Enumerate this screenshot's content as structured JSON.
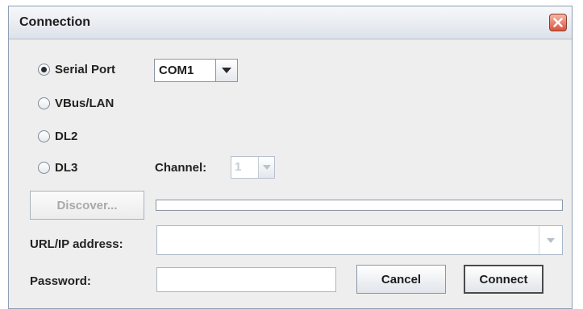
{
  "window": {
    "title": "Connection"
  },
  "connection_types": [
    {
      "label": "Serial Port",
      "selected": true
    },
    {
      "label": "VBus/LAN",
      "selected": false
    },
    {
      "label": "DL2",
      "selected": false
    },
    {
      "label": "DL3",
      "selected": false
    }
  ],
  "serial_port": {
    "value": "COM1"
  },
  "channel": {
    "label": "Channel:",
    "value": "1",
    "enabled": false
  },
  "discover": {
    "label": "Discover...",
    "enabled": false,
    "progress": 0
  },
  "url": {
    "label": "URL/IP address:",
    "value": "",
    "placeholder": ""
  },
  "password": {
    "label": "Password:",
    "value": "",
    "placeholder": ""
  },
  "buttons": {
    "cancel": "Cancel",
    "connect": "Connect"
  },
  "icons": {
    "close": "close-icon",
    "radio": "radio-icon",
    "dropdown": "chevron-down-icon"
  },
  "colors": {
    "dialog_bg": "#eeeeee",
    "close_button": "#d9533b",
    "border": "#8a96a3",
    "disabled_text": "#a9a9a9"
  }
}
